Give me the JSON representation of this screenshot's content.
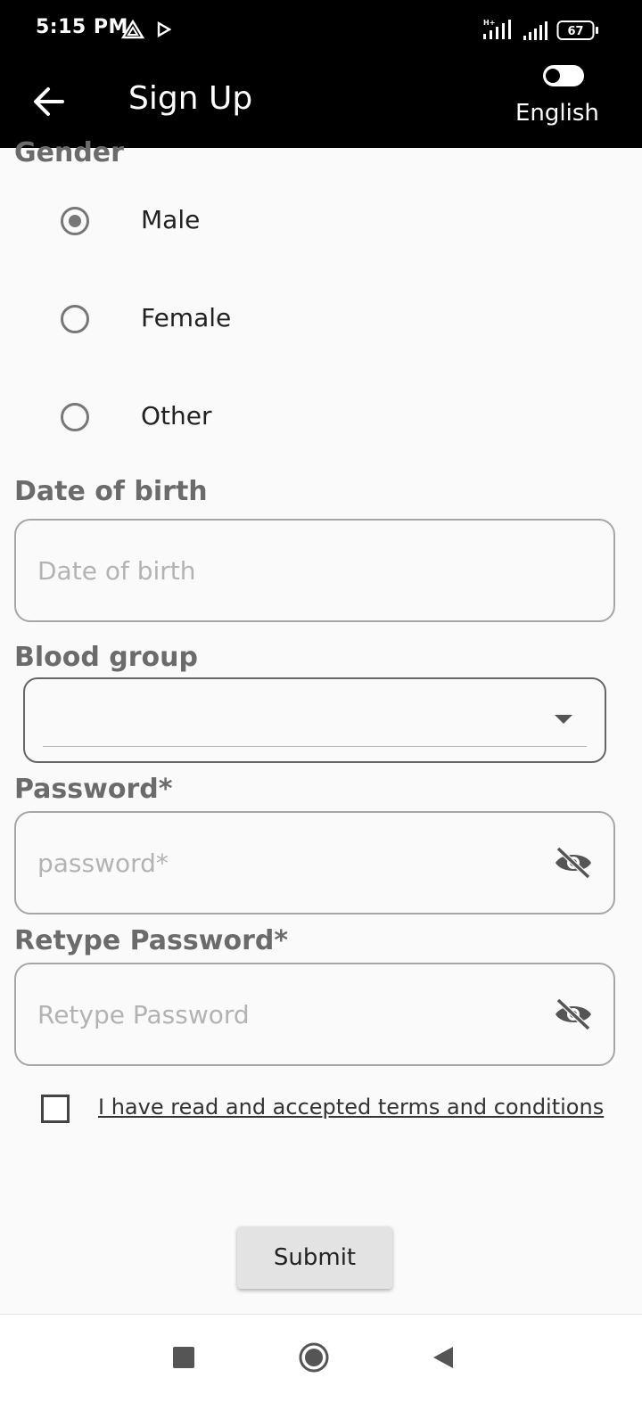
{
  "status_bar": {
    "time": "5:15 PM",
    "battery": "67",
    "icons": [
      "drive-icon",
      "play-icon",
      "hplus-signal-icon",
      "signal-icon",
      "battery-icon"
    ]
  },
  "app_bar": {
    "title": "Sign Up",
    "language": "English",
    "back_icon": "arrow-left-icon",
    "toggle_icon": "toggle-icon"
  },
  "form": {
    "gender": {
      "label": "Gender",
      "options": [
        {
          "label": "Male",
          "selected": true
        },
        {
          "label": "Female",
          "selected": false
        },
        {
          "label": "Other",
          "selected": false
        }
      ]
    },
    "dob": {
      "label": "Date of birth",
      "placeholder": "Date of birth",
      "value": ""
    },
    "blood_group": {
      "label": "Blood group",
      "value": ""
    },
    "password": {
      "label": "Password*",
      "placeholder": "password*",
      "value": ""
    },
    "retype_password": {
      "label": "Retype Password*",
      "placeholder": "Retype Password",
      "value": ""
    },
    "terms": {
      "label": "I have read and accepted terms and conditions",
      "checked": false
    },
    "submit_label": "Submit"
  },
  "nav_bar": {
    "icons": [
      "recents-square-icon",
      "home-circle-icon",
      "back-triangle-icon"
    ]
  },
  "colors": {
    "app_bar_bg": "#000000",
    "background": "#fafafa",
    "label_gray": "#6b6b6b",
    "border_gray": "#a6a6a6"
  }
}
